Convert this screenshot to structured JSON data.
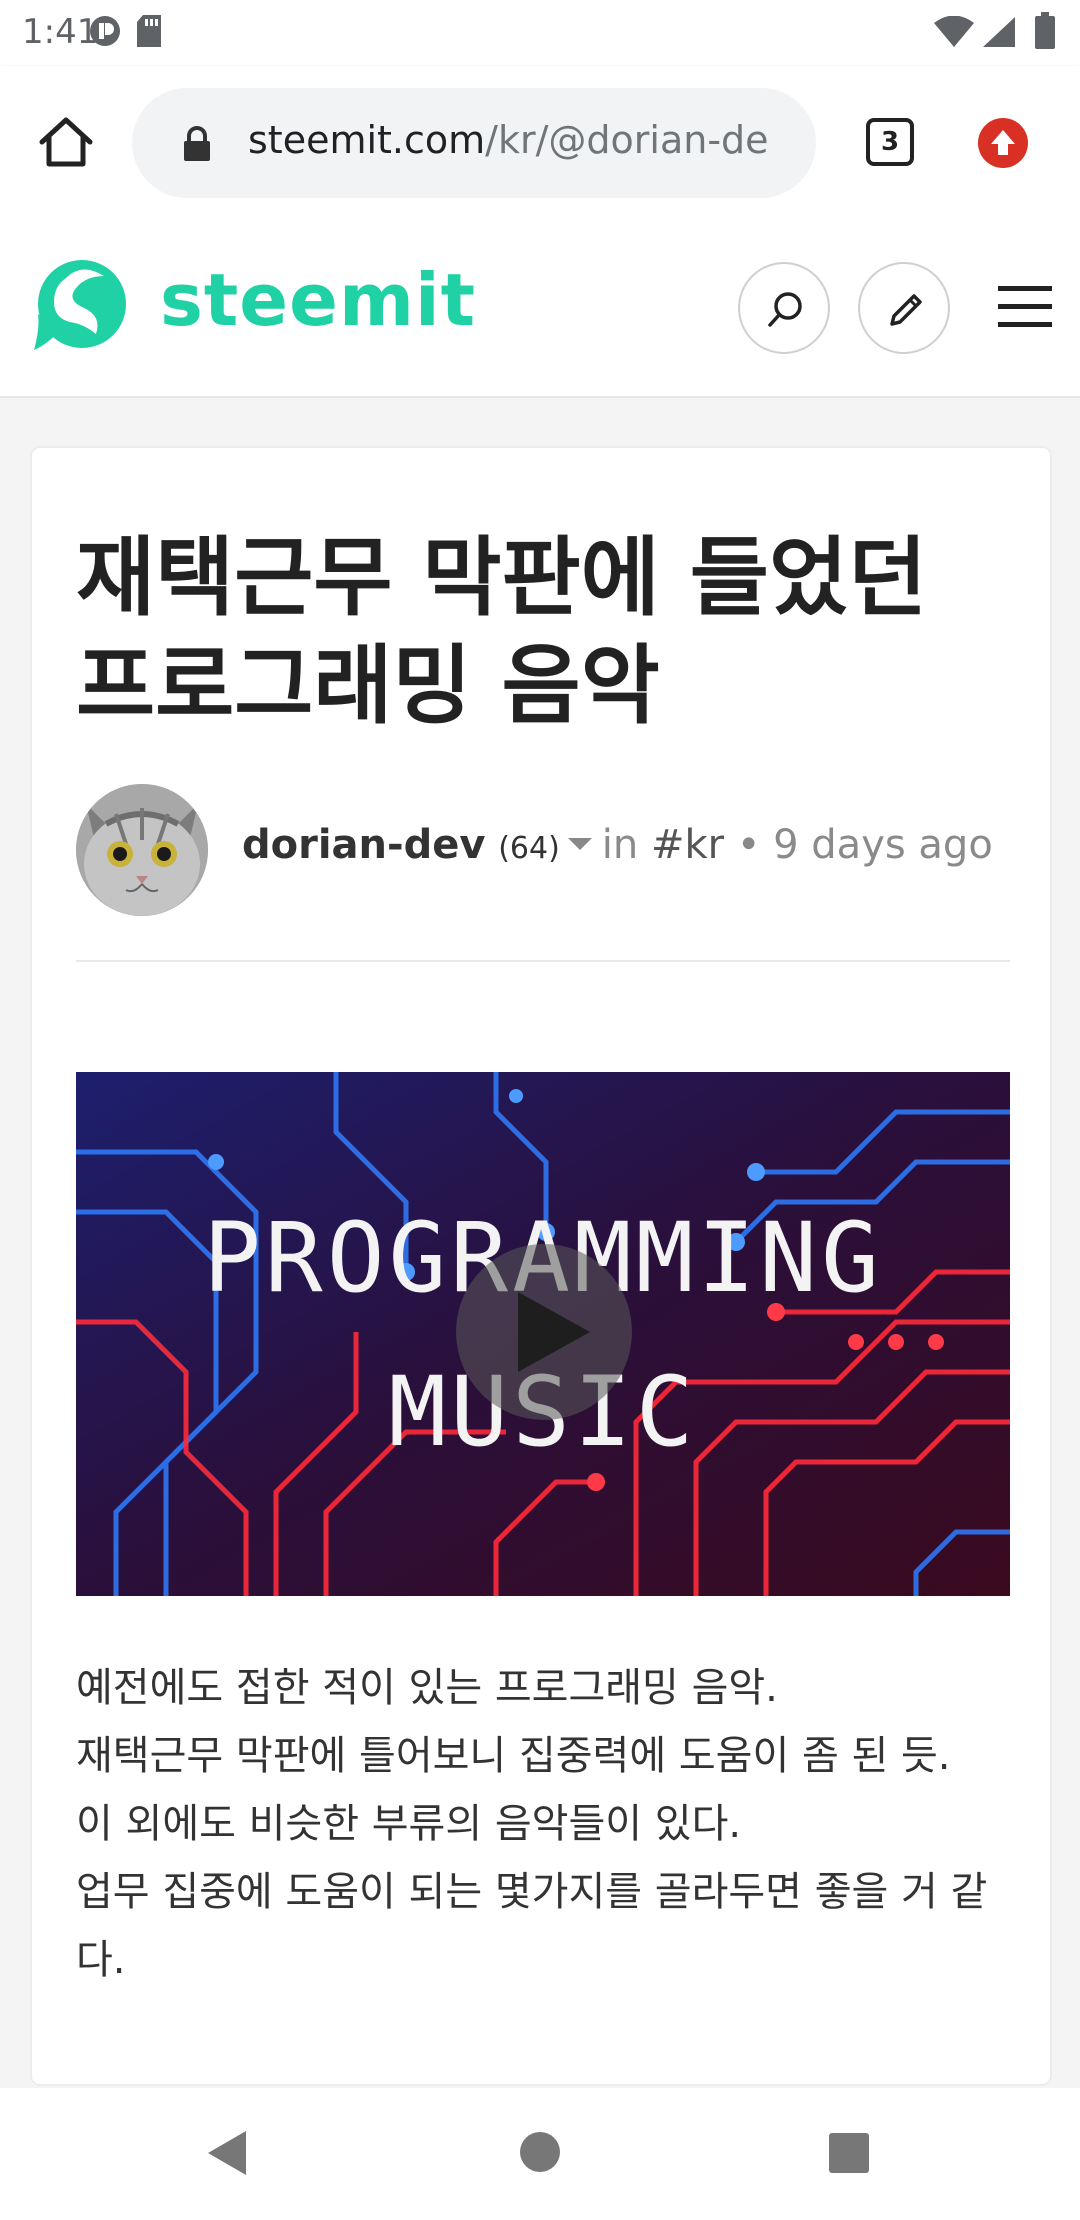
{
  "status_bar": {
    "time": "1:41"
  },
  "browser": {
    "url_host": "steemit.com",
    "url_path": "/kr/@dorian-de",
    "tab_count": "3"
  },
  "site": {
    "logo_text": "steemit",
    "brand_color": "#1fd1a4"
  },
  "post": {
    "title": "재택근무 막판에 들었던 프로그래밍 음악",
    "author": "dorian-dev",
    "reputation": "(64)",
    "in_label": "in",
    "tag": "#kr",
    "separator": "•",
    "posted": "9 days ago",
    "video": {
      "line1": "PROGRAMMING",
      "line2": "MUSIC"
    },
    "body": [
      "예전에도 접한 적이 있는 프로그래밍 음악.",
      "재택근무 막판에 틀어보니 집중력에 도움이 좀 된 듯.",
      "이 외에도 비슷한 부류의 음악들이 있다.",
      "업무 집중에 도움이 되는 몇가지를 골라두면 좋을 거 같다."
    ]
  },
  "icons": {
    "home": "home-icon",
    "lock": "lock-icon",
    "tabs": "tabs-icon",
    "upload": "upload-icon",
    "search": "search-icon",
    "edit": "pencil-icon",
    "menu": "hamburger-icon",
    "play": "play-icon",
    "back": "back-icon",
    "home_nav": "home-circle-icon",
    "recents": "recents-icon"
  }
}
